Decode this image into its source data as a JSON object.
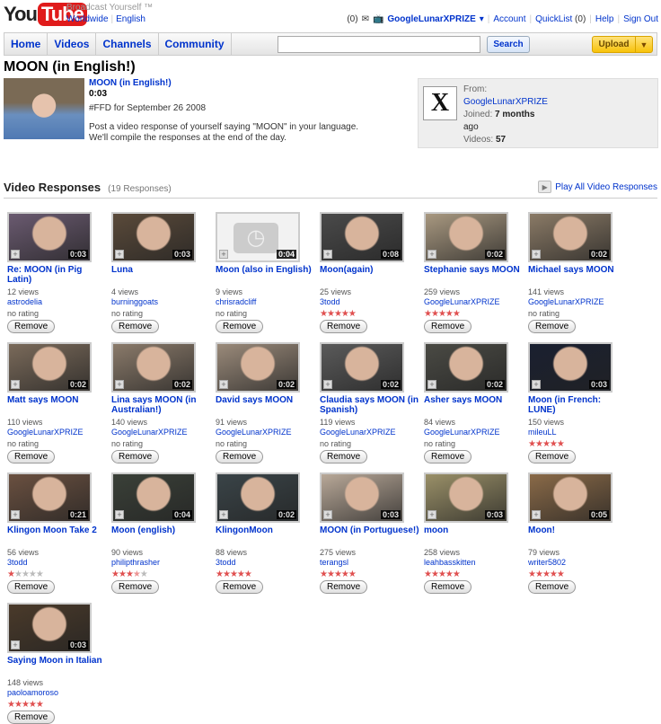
{
  "header": {
    "logo_text": "YouTube",
    "logo_you": "You",
    "logo_tube": "Tube",
    "tagline": "Broadcast Yourself ™",
    "locale_region": "Worldwide",
    "locale_language": "English",
    "inbox_count": "(0)",
    "username": "GoogleLunarXPRIZE",
    "account": "Account",
    "quicklist": "QuickList",
    "quicklist_count": "(0)",
    "help": "Help",
    "sign_out": "Sign Out"
  },
  "nav": {
    "tabs": [
      "Home",
      "Videos",
      "Channels",
      "Community"
    ],
    "search_value": "",
    "search_button": "Search",
    "upload_button": "Upload"
  },
  "video": {
    "page_title": "MOON (in English!)",
    "title": "MOON (in English!)",
    "duration": "0:03",
    "tag": "#FFD for September 26 2008",
    "description_line1": "Post a video response of yourself saying \"MOON\" in your language.",
    "description_line2": "We'll compile the responses at the end of the day."
  },
  "from": {
    "label": "From:",
    "channel": "GoogleLunarXPRIZE",
    "joined_label": "Joined:",
    "joined_value": "7 months",
    "joined_suffix": "ago",
    "videos_label": "Videos:",
    "videos_value": "57",
    "avatar_letter": "X"
  },
  "responses": {
    "heading": "Video Responses",
    "count": "(19 Responses)",
    "play_all": "Play All Video Responses",
    "remove_label": "Remove",
    "no_rating": "no rating",
    "items": [
      {
        "title": "Re: MOON (in Pig Latin)",
        "duration": "0:03",
        "views": "12 views",
        "author": "astrodelia",
        "rating": null,
        "color": "#6a5a70"
      },
      {
        "title": "Luna",
        "duration": "0:03",
        "views": "4 views",
        "author": "burninggoats",
        "rating": null,
        "color": "#5a4a3a"
      },
      {
        "title": "Moon (also in English)",
        "duration": "0:04",
        "views": "9 views",
        "author": "chrisradcliff",
        "rating": null,
        "color": "placeholder"
      },
      {
        "title": "Moon(again)",
        "duration": "0:08",
        "views": "25 views",
        "author": "3todd",
        "rating": 5,
        "color": "#4a4a4a"
      },
      {
        "title": "Stephanie says MOON",
        "duration": "0:02",
        "views": "259 views",
        "author": "GoogleLunarXPRIZE",
        "rating": 5,
        "color": "#a89880"
      },
      {
        "title": "Michael says MOON",
        "duration": "0:02",
        "views": "141 views",
        "author": "GoogleLunarXPRIZE",
        "rating": null,
        "color": "#8a7a66"
      },
      {
        "title": "Matt says MOON",
        "duration": "0:02",
        "views": "110 views",
        "author": "GoogleLunarXPRIZE",
        "rating": null,
        "color": "#7a6a5a"
      },
      {
        "title": "Lina says MOON (in Australian!)",
        "duration": "0:02",
        "views": "140 views",
        "author": "GoogleLunarXPRIZE",
        "rating": null,
        "color": "#8a7a6a"
      },
      {
        "title": "David says MOON",
        "duration": "0:02",
        "views": "91 views",
        "author": "GoogleLunarXPRIZE",
        "rating": null,
        "color": "#9a8a7a"
      },
      {
        "title": "Claudia says MOON (in Spanish)",
        "duration": "0:02",
        "views": "119 views",
        "author": "GoogleLunarXPRIZE",
        "rating": null,
        "color": "#5a5a5a"
      },
      {
        "title": "Asher says MOON",
        "duration": "0:02",
        "views": "84 views",
        "author": "GoogleLunarXPRIZE",
        "rating": null,
        "color": "#4a4a44"
      },
      {
        "title": "Moon (in French: LUNE)",
        "duration": "0:03",
        "views": "150 views",
        "author": "mileuLL",
        "rating": 5,
        "color": "#1a2030"
      },
      {
        "title": "Klingon Moon Take 2",
        "duration": "0:21",
        "views": "56 views",
        "author": "3todd",
        "rating": 1,
        "color": "#6a5040"
      },
      {
        "title": "Moon (english)",
        "duration": "0:04",
        "views": "90 views",
        "author": "philipthrasher",
        "rating": 3.5,
        "color": "#3a4038"
      },
      {
        "title": "KlingonMoon",
        "duration": "0:02",
        "views": "88 views",
        "author": "3todd",
        "rating": 5,
        "color": "#3a4448"
      },
      {
        "title": "MOON (in Portuguese!)",
        "duration": "0:03",
        "views": "275 views",
        "author": "terangsl",
        "rating": 5,
        "color": "#b8a898"
      },
      {
        "title": "moon",
        "duration": "0:03",
        "views": "258 views",
        "author": "leahbasskitten",
        "rating": 5,
        "color": "#9a9068"
      },
      {
        "title": "Moon!",
        "duration": "0:05",
        "views": "79 views",
        "author": "writer5802",
        "rating": 5,
        "color": "#8a6a48"
      },
      {
        "title": "Saying Moon in Italian",
        "duration": "0:03",
        "views": "148 views",
        "author": "paoloamoroso",
        "rating": 5,
        "color": "#4a3a2a"
      }
    ]
  },
  "colors": {
    "link": "#0033cc",
    "star_on": "#e05050",
    "star_off": "#bbbbbb",
    "logo_red": "#e01b1b",
    "upload": "#f7c20a"
  }
}
